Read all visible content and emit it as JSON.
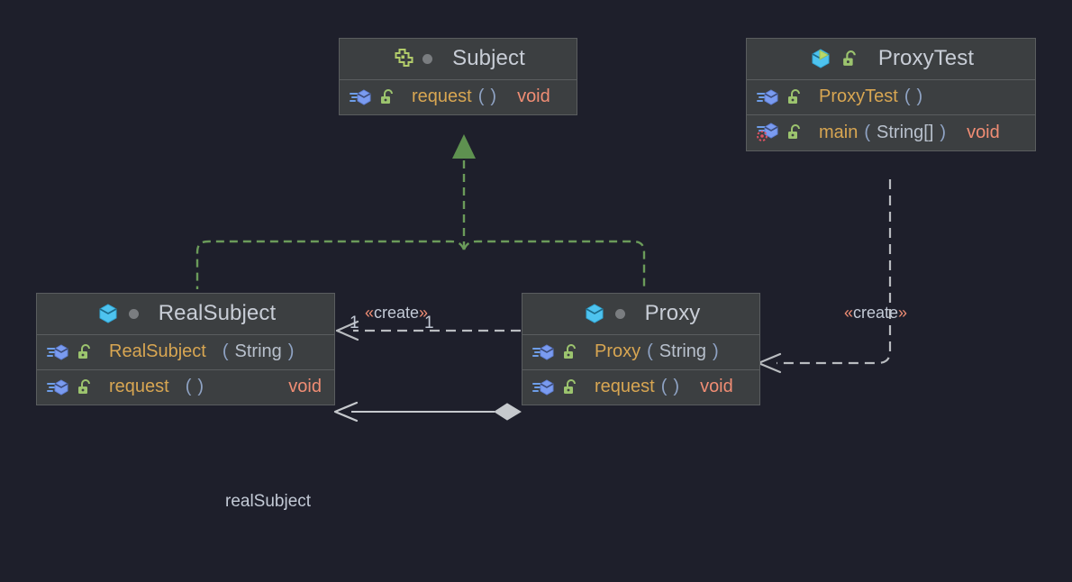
{
  "diagram": {
    "title": "Proxy pattern UML class diagram",
    "background_color": "#1e1f2b",
    "box_fill": "#3c3f41",
    "box_border": "#5a5d5f"
  },
  "classes": [
    {
      "id": "subject",
      "name": "Subject",
      "kind": "interface",
      "header_icon": "interface-icon",
      "header_marker": "grey-dot-icon",
      "members": [
        {
          "icon": "method-icon",
          "visibility_icon": "unlock-public-icon",
          "name": "request",
          "params": "",
          "paren_open": "(",
          "paren_close": ")",
          "return": "void",
          "return_align": "inline"
        }
      ]
    },
    {
      "id": "proxytest",
      "name": "ProxyTest",
      "kind": "class-runnable",
      "header_icon": "class-run-icon",
      "header_marker": "unlock-public-icon",
      "members": [
        {
          "icon": "method-icon",
          "visibility_icon": "unlock-public-icon",
          "name": "ProxyTest",
          "params": "",
          "paren_open": "(",
          "paren_close": ")",
          "return": "",
          "return_align": "inline"
        },
        {
          "icon": "method-run-icon",
          "visibility_icon": "unlock-public-icon",
          "name": "main",
          "params": "String[]",
          "paren_open": "(",
          "paren_close": ")",
          "return": "void",
          "return_align": "inline"
        }
      ]
    },
    {
      "id": "realsubject",
      "name": "RealSubject",
      "kind": "class",
      "header_icon": "class-icon",
      "header_marker": "grey-dot-icon",
      "members": [
        {
          "icon": "method-icon",
          "visibility_icon": "unlock-public-icon",
          "name": "RealSubject",
          "params": "String",
          "paren_open": "(",
          "paren_close": ")",
          "return": "",
          "return_align": "inline"
        },
        {
          "icon": "method-icon",
          "visibility_icon": "unlock-public-icon",
          "name": "request",
          "params": "",
          "paren_open": "(",
          "paren_close": ")",
          "return": "void",
          "return_align": "right"
        }
      ]
    },
    {
      "id": "proxy",
      "name": "Proxy",
      "kind": "class",
      "header_icon": "class-icon",
      "header_marker": "grey-dot-icon",
      "members": [
        {
          "icon": "method-icon",
          "visibility_icon": "unlock-public-icon",
          "name": "Proxy",
          "params": "String",
          "paren_open": "(",
          "paren_close": ")",
          "return": "",
          "return_align": "inline"
        },
        {
          "icon": "method-icon",
          "visibility_icon": "unlock-public-icon",
          "name": "request",
          "params": "",
          "paren_open": "(",
          "paren_close": ")",
          "return": "void",
          "return_align": "inline"
        }
      ]
    }
  ],
  "edges": [
    {
      "id": "realization-realsubject-subject",
      "type": "realization",
      "from": "RealSubject",
      "to": "Subject",
      "style": "dashed",
      "color": "#6b9b5a",
      "arrow": "hollow-triangle-filled"
    },
    {
      "id": "realization-proxy-subject",
      "type": "realization",
      "from": "Proxy",
      "to": "Subject",
      "style": "dashed",
      "color": "#6b9b5a",
      "arrow": "hollow-triangle-filled"
    },
    {
      "id": "dependency-proxy-realsubject",
      "type": "dependency",
      "from": "Proxy",
      "to": "RealSubject",
      "style": "dashed",
      "color": "#b9bcc0",
      "arrow": "open",
      "stereotype": "«create»",
      "source_multiplicity": "1",
      "target_multiplicity": "1"
    },
    {
      "id": "dependency-proxytest-proxy",
      "type": "dependency",
      "from": "ProxyTest",
      "to": "Proxy",
      "style": "dashed",
      "color": "#b9bcc0",
      "arrow": "open",
      "stereotype": "«create»"
    },
    {
      "id": "aggregation-proxy-realsubject",
      "type": "aggregation",
      "from": "Proxy",
      "to": "RealSubject",
      "style": "solid",
      "color": "#c6c9cd",
      "arrow": "open",
      "diamond": "filled",
      "field_label": "realSubject"
    }
  ],
  "labels": {
    "create_left": {
      "open": "«",
      "text": "create",
      "close": "»"
    },
    "create_right": {
      "open": "«",
      "text": "create",
      "close": "»"
    },
    "mult_source": "1",
    "mult_target": "1",
    "field_name": "realSubject"
  }
}
